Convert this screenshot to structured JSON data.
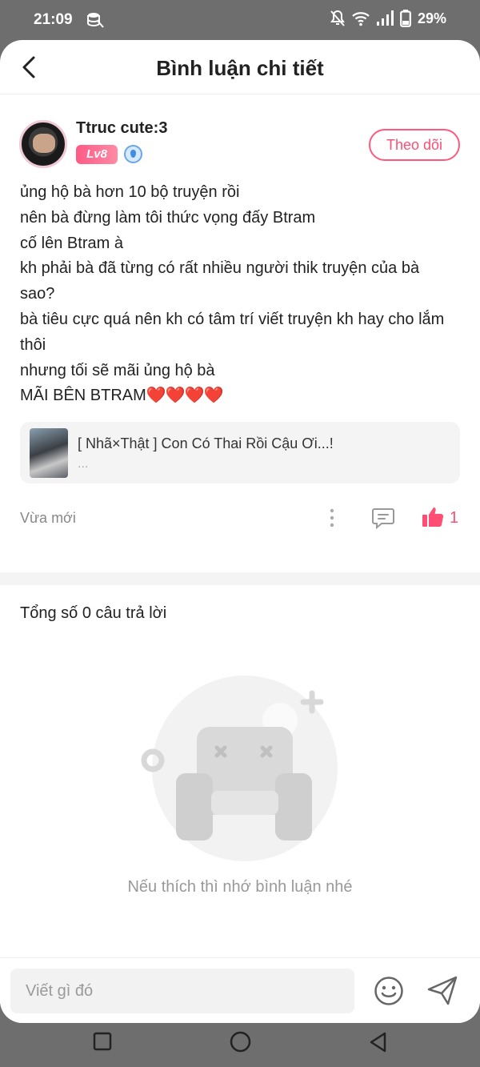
{
  "status": {
    "time": "21:09",
    "battery": "29%"
  },
  "header": {
    "title": "Bình luận chi tiết"
  },
  "comment": {
    "author": "Ttruc cute:3",
    "level": "Lv8",
    "follow_label": "Theo dõi",
    "lines": [
      "ủng hộ bà hơn 10 bộ truyện rồi",
      "nên bà đừng làm tôi thức vọng đấy Btram",
      "cố lên Btram à",
      "kh phải bà đã từng có rất nhiều người thik truyện của bà sao?",
      "bà tiêu cực quá nên kh có tâm trí viết truyện kh hay cho lắm thôi",
      "nhưng tối sẽ mãi ủng hộ bà"
    ],
    "last_line": "MÃI BÊN BTRAM",
    "last_line_emoji": "❤️❤️❤️❤️",
    "story": {
      "title": "[ Nhã×Thật ] Con Có Thai Rồi Cậu Ơi...!",
      "subtitle": "..."
    },
    "time": "Vừa mới",
    "likes": "1"
  },
  "replies": {
    "total_label": "Tổng số 0 câu trả lời",
    "empty_text": "Nếu thích thì nhớ bình luận nhé"
  },
  "input": {
    "placeholder": "Viết gì đó"
  },
  "colors": {
    "accent": "#ff4d73",
    "text": "#222222",
    "muted": "#888888"
  },
  "icons": {
    "back": "back-arrow-icon",
    "more": "more-vertical-icon",
    "comment": "comment-icon",
    "like": "thumbs-up-icon",
    "emoji": "smiley-icon",
    "send": "send-icon"
  }
}
